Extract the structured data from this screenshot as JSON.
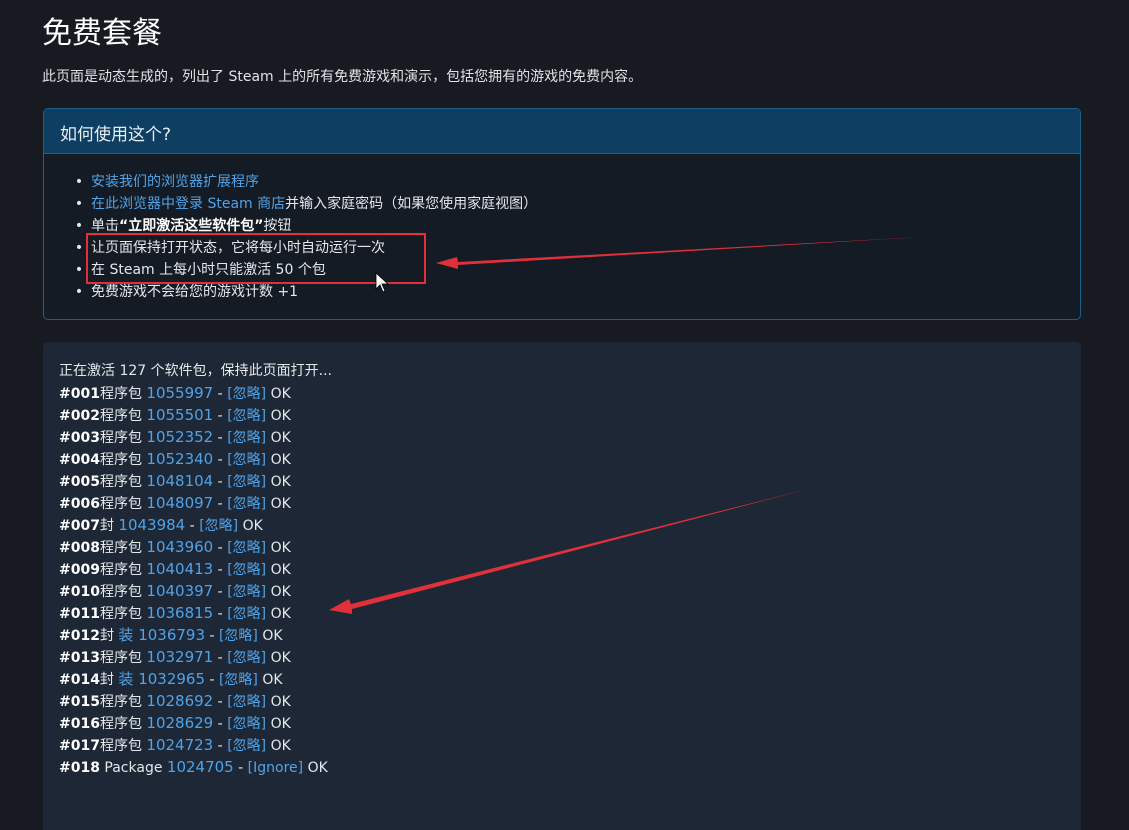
{
  "page": {
    "title": "免费套餐",
    "description": "此页面是动态生成的，列出了 Steam 上的所有免费游戏和演示，包括您拥有的游戏的免费内容。"
  },
  "help": {
    "header": "如何使用这个?",
    "items": [
      {
        "link": "安装我们的浏览器扩展程序",
        "text": ""
      },
      {
        "link": "在此浏览器中登录 Steam 商店",
        "text": "并输入家庭密码（如果您使用家庭视图）"
      },
      {
        "pre": "单击",
        "bold": "“立即激活这些软件包”",
        "text": "按钮"
      },
      {
        "text": "让页面保持打开状态，它将每小时自动运行一次"
      },
      {
        "text": "在 Steam 上每小时只能激活 50 个包"
      },
      {
        "text": "免费游戏不会给您的游戏计数 +1"
      }
    ]
  },
  "log": {
    "status": "正在激活 127 个软件包，保持此页面打开...",
    "entries": [
      {
        "num": "#001",
        "type": "程序包",
        "id": "1055997",
        "ignore": "[忽略]",
        "result": "OK"
      },
      {
        "num": "#002",
        "type": "程序包",
        "id": "1055501",
        "ignore": "[忽略]",
        "result": "OK"
      },
      {
        "num": "#003",
        "type": "程序包",
        "id": "1052352",
        "ignore": "[忽略]",
        "result": "OK"
      },
      {
        "num": "#004",
        "type": "程序包",
        "id": "1052340",
        "ignore": "[忽略]",
        "result": "OK"
      },
      {
        "num": "#005",
        "type": "程序包",
        "id": "1048104",
        "ignore": "[忽略]",
        "result": "OK"
      },
      {
        "num": "#006",
        "type": "程序包",
        "id": "1048097",
        "ignore": "[忽略]",
        "result": "OK"
      },
      {
        "num": "#007",
        "type": "封",
        "id": "1043984",
        "ignore": "[忽略]",
        "result": "OK"
      },
      {
        "num": "#008",
        "type": "程序包",
        "id": "1043960",
        "ignore": "[忽略]",
        "result": "OK"
      },
      {
        "num": "#009",
        "type": "程序包",
        "id": "1040413",
        "ignore": "[忽略]",
        "result": "OK"
      },
      {
        "num": "#010",
        "type": "程序包",
        "id": "1040397",
        "ignore": "[忽略]",
        "result": "OK"
      },
      {
        "num": "#011",
        "type": "程序包",
        "id": "1036815",
        "ignore": "[忽略]",
        "result": "OK"
      },
      {
        "num": "#012",
        "type": "封",
        "id": "装 1036793",
        "ignore": "[忽略]",
        "result": "OK"
      },
      {
        "num": "#013",
        "type": "程序包",
        "id": "1032971",
        "ignore": "[忽略]",
        "result": "OK"
      },
      {
        "num": "#014",
        "type": "封",
        "id": "装 1032965",
        "ignore": "[忽略]",
        "result": "OK"
      },
      {
        "num": "#015",
        "type": "程序包",
        "id": "1028692",
        "ignore": "[忽略]",
        "result": "OK"
      },
      {
        "num": "#016",
        "type": "程序包",
        "id": "1028629",
        "ignore": "[忽略]",
        "result": "OK"
      },
      {
        "num": "#017",
        "type": "程序包",
        "id": "1024723",
        "ignore": "[忽略]",
        "result": "OK"
      },
      {
        "num": "#018",
        "type": " Package",
        "id": "1024705",
        "ignore": "[Ignore]",
        "result": "OK"
      }
    ]
  },
  "colors": {
    "background": "#171a21",
    "link": "#4fa3e8",
    "annotation": "#e0303a"
  }
}
